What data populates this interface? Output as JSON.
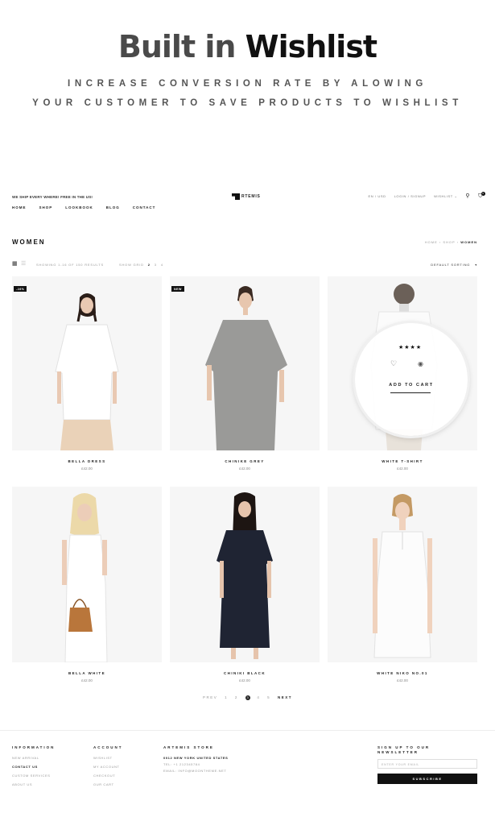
{
  "promo": {
    "title_light": "Built in",
    "title_dark": "Wishlist",
    "subtitle_line1": "INCREASE CONVERSION RATE BY ALOWING",
    "subtitle_line2": "YOUR CUSTOMER TO SAVE PRODUCTS TO WISHLIST"
  },
  "store": {
    "shipping_note": "WE SHIP EVERY WHERE! FREE IN THE US!",
    "logo_text": "RTEMIS",
    "top_links": [
      "EN / USD",
      "LOGIN / SIGNUP",
      "WISHLIST"
    ],
    "cart_count": "0",
    "nav": [
      "HOME",
      "SHOP",
      "LOOKBOOK",
      "BLOG",
      "CONTACT"
    ],
    "page_title": "WOMEN",
    "breadcrumb": [
      "HOME",
      "SHOP",
      "WOMEN"
    ],
    "result_count": "SHOWING 1-16 OF 150 RESULTS",
    "show_grid_label": "SHOW GRID",
    "grid_options": [
      "2",
      "3",
      "4"
    ],
    "sort_label": "DEFAULT SORTING",
    "products": [
      {
        "name": "BELLA DRESS",
        "price": "£42.00",
        "badge": "-28%"
      },
      {
        "name": "CHINIKE GREY",
        "price": "£42.00",
        "badge": "NEW"
      },
      {
        "name": "WHITE T-SHIRT",
        "price": "£42.00",
        "badge": ""
      },
      {
        "name": "BELLA WHITE",
        "price": "£42.00",
        "badge": ""
      },
      {
        "name": "CHINIKI BLACK",
        "price": "£42.00",
        "badge": ""
      },
      {
        "name": "WHITE NIKO NO.01",
        "price": "£42.00",
        "badge": ""
      }
    ],
    "quick_view": {
      "rating": "★★★★",
      "add_to_cart": "ADD TO CART"
    },
    "pager": {
      "prev": "PREV",
      "pages": [
        "1",
        "2",
        "3",
        "4",
        "5"
      ],
      "current": "3",
      "next": "NEXT"
    },
    "footer": {
      "information": {
        "title": "INFORMATION",
        "links": [
          "NEW ARRIVAL",
          "CONTACT US",
          "CUSTOM SERVICES",
          "ABOUT US"
        ]
      },
      "account": {
        "title": "ACCOUNT",
        "links": [
          "WISHLIST",
          "MY ACCOUNT",
          "CHECKOUT",
          "OUR CART"
        ]
      },
      "store_info": {
        "title": "ARTEMIS STORE",
        "address": "0012 NEW YORK UNITED STATES",
        "tel": "TEL: +1 212345784",
        "email": "EMAIL: INFO@MOONTHEME.NET"
      },
      "newsletter": {
        "title_line1": "SIGN UP TO OUR",
        "title_line2": "NEWSLETTER",
        "placeholder": "ENTER YOUR EMAIL",
        "button": "SUBSCRIBE"
      }
    }
  },
  "colors": {
    "accent": "#111111",
    "muted": "#999999",
    "image_bg": "#f4f4f4"
  }
}
